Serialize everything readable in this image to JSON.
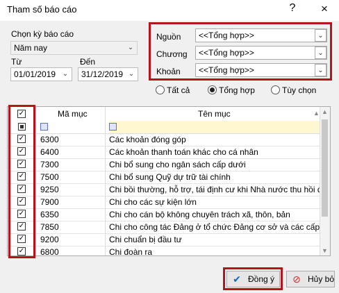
{
  "window": {
    "title": "Tham số báo cáo",
    "help_icon": "?",
    "close_icon": "×"
  },
  "period": {
    "label": "Chọn kỳ báo cáo",
    "value": "Năm nay",
    "from_label": "Từ",
    "from_value": "01/01/2019",
    "to_label": "Đến",
    "to_value": "31/12/2019"
  },
  "sources": [
    {
      "label": "Nguồn",
      "value": "<<Tổng hợp>>"
    },
    {
      "label": "Chương",
      "value": "<<Tổng hợp>>"
    },
    {
      "label": "Khoản",
      "value": "<<Tổng hợp>>"
    }
  ],
  "radios": [
    {
      "label": "Tất cả",
      "checked": false
    },
    {
      "label": "Tổng hợp",
      "checked": true
    },
    {
      "label": "Tùy chọn",
      "checked": false
    }
  ],
  "grid": {
    "col_code": "Mã mục",
    "col_name": "Tên mục",
    "rows": [
      {
        "code": "6300",
        "name": "Các khoản đóng góp",
        "checked": true
      },
      {
        "code": "6400",
        "name": "Các khoản thanh toán khác cho cá nhân",
        "checked": true
      },
      {
        "code": "7300",
        "name": "Chi bổ sung cho ngân sách cấp dưới",
        "checked": true
      },
      {
        "code": "7500",
        "name": "Chi bổ sung Quỹ dự trữ tài chính",
        "checked": true
      },
      {
        "code": "9250",
        "name": "Chi bồi thường, hỗ trợ, tái định cư khi Nhà nước thu hồi đất",
        "checked": true
      },
      {
        "code": "7900",
        "name": "Chi cho các sự kiện lớn",
        "checked": true
      },
      {
        "code": "6350",
        "name": "Chi cho cán bộ không chuyên trách xã, thôn, bản",
        "checked": true
      },
      {
        "code": "7850",
        "name": "Chi cho công tác Đảng ở tổ chức Đảng cơ sở và các cấp trê...",
        "checked": true
      },
      {
        "code": "9200",
        "name": "Chi chuẩn bị đầu tư",
        "checked": true
      },
      {
        "code": "6800",
        "name": "Chi đoàn ra",
        "checked": true
      }
    ]
  },
  "buttons": {
    "ok": "Đồng ý",
    "cancel": "Hủy bỏ"
  },
  "colors": {
    "highlight": "#b5141c"
  }
}
